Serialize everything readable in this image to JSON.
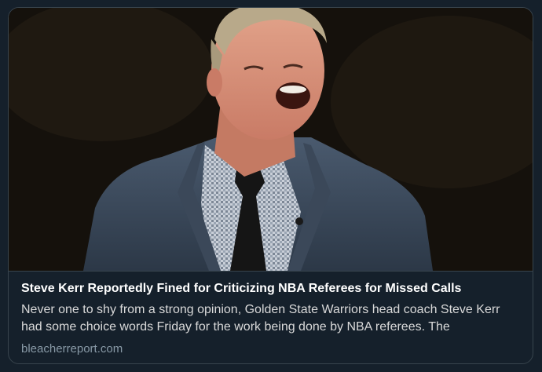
{
  "link_card": {
    "image_alt": "Steve Kerr",
    "title": "Steve Kerr Reportedly Fined for Criticizing NBA Referees for Missed Calls",
    "description": "Never one to shy from a strong opinion, Golden State Warriors head coach Steve Kerr had some choice words Friday for the work being done by NBA referees. The",
    "domain": "bleacherreport.com"
  },
  "colors": {
    "background": "#15202b",
    "border": "#38444d",
    "title": "#ffffff",
    "description": "#d9d9d9",
    "domain": "#8899a6"
  }
}
